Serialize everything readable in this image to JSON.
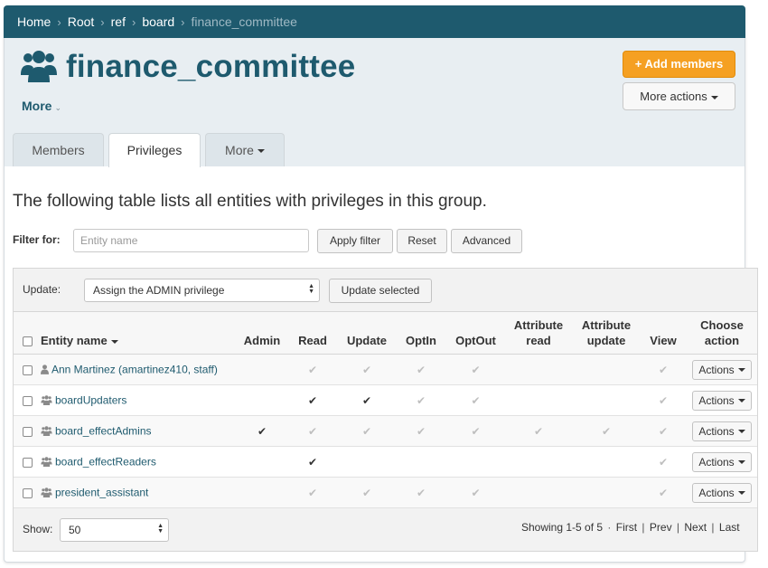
{
  "breadcrumb": {
    "items": [
      "Home",
      "Root",
      "ref",
      "board"
    ],
    "current": "finance_committee",
    "separator": "›"
  },
  "header": {
    "title": "finance_committee",
    "more_label": "More",
    "add_members_label": "Add members",
    "add_members_icon": "+",
    "more_actions_label": "More actions"
  },
  "tabs": {
    "members": "Members",
    "privileges": "Privileges",
    "more": "More"
  },
  "content": {
    "lead": "The following table lists all entities with privileges in this group.",
    "filter_label": "Filter for:",
    "filter_placeholder": "Entity name",
    "filter_value": "",
    "apply_filter": "Apply filter",
    "reset": "Reset",
    "advanced": "Advanced"
  },
  "update_bar": {
    "label": "Update:",
    "selected_option": "Assign the ADMIN privilege",
    "update_selected": "Update selected"
  },
  "table": {
    "col_entity": "Entity name",
    "col_admin": "Admin",
    "col_read": "Read",
    "col_update": "Update",
    "col_optin": "OptIn",
    "col_optout": "OptOut",
    "col_attr_read_1": "Attribute",
    "col_attr_read_2": "read",
    "col_attr_update_1": "Attribute",
    "col_attr_update_2": "update",
    "col_view": "View",
    "col_action_1": "Choose",
    "col_action_2": "action",
    "actions_label": "Actions",
    "rows": [
      {
        "name": "Ann Martinez (amartinez410, staff)",
        "type": "person",
        "privs": [
          "",
          "inherited",
          "inherited",
          "inherited",
          "inherited",
          "",
          "",
          "inherited"
        ]
      },
      {
        "name": "boardUpdaters",
        "type": "group",
        "privs": [
          "",
          "direct",
          "direct",
          "inherited",
          "inherited",
          "",
          "",
          "inherited"
        ]
      },
      {
        "name": "board_effectAdmins",
        "type": "group",
        "privs": [
          "direct",
          "inherited",
          "inherited",
          "inherited",
          "inherited",
          "inherited",
          "inherited",
          "inherited"
        ]
      },
      {
        "name": "board_effectReaders",
        "type": "group",
        "privs": [
          "",
          "direct",
          "",
          "",
          "",
          "",
          "",
          "inherited"
        ]
      },
      {
        "name": "president_assistant",
        "type": "group",
        "privs": [
          "",
          "inherited",
          "inherited",
          "inherited",
          "inherited",
          "",
          "",
          "inherited"
        ]
      }
    ]
  },
  "footer": {
    "show_label": "Show:",
    "show_value": "50",
    "showing_text": "Showing 1-5 of 5",
    "dot": "·",
    "first": "First",
    "prev": "Prev",
    "next": "Next",
    "last": "Last",
    "pipe": "|"
  },
  "colors": {
    "brand": "#1e5a6e",
    "accent": "#f5a022",
    "header_bg": "#e8eef2",
    "check_direct": "#333333",
    "check_inherited": "#bfbfbf"
  },
  "icons": {
    "group": "group-icon",
    "person": "person-icon",
    "check": "check-icon",
    "caret": "caret-down-icon"
  }
}
